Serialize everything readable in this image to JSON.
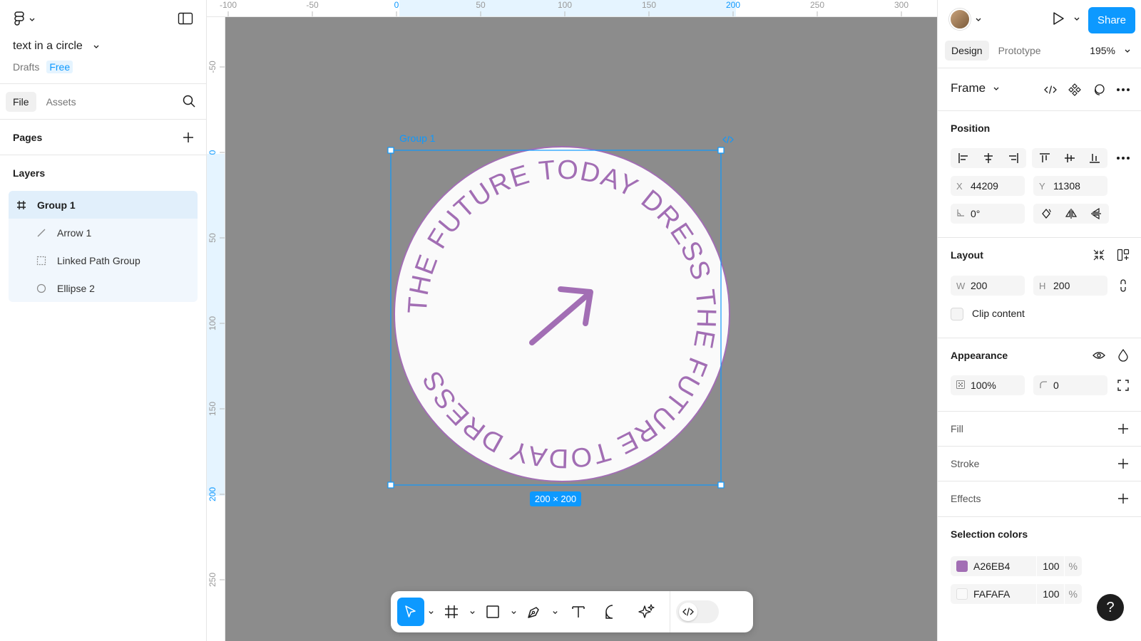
{
  "file": {
    "title": "text in a circle",
    "location": "Drafts",
    "plan_badge": "Free"
  },
  "left_tabs": {
    "file": "File",
    "assets": "Assets"
  },
  "pages_label": "Pages",
  "layers_label": "Layers",
  "layers": [
    {
      "name": "Group 1",
      "icon": "frame-grid-icon"
    },
    {
      "name": "Arrow 1",
      "icon": "line-icon"
    },
    {
      "name": "Linked Path Group",
      "icon": "dashed-box-icon"
    },
    {
      "name": "Ellipse 2",
      "icon": "ellipse-icon"
    }
  ],
  "ruler_top": [
    "-100",
    "-50",
    "0",
    "50",
    "100",
    "150",
    "200",
    "250",
    "300"
  ],
  "ruler_left": [
    "-50",
    "0",
    "50",
    "100",
    "150",
    "200",
    "250"
  ],
  "canvas": {
    "selection_label": "Group 1",
    "size_badge": "200 × 200",
    "circle_text": "THE FUTURE TODAY DRESS THE FUTURE TODAY DRESS",
    "accent_color": "#A26EB4",
    "fill_color": "#FAFAFA",
    "selection_color": "#0D99FF"
  },
  "right_panel": {
    "share_label": "Share",
    "tab_design": "Design",
    "tab_prototype": "Prototype",
    "zoom": "195%",
    "frame_label": "Frame",
    "position": {
      "title": "Position",
      "x_label": "X",
      "x_value": "44209",
      "y_label": "Y",
      "y_value": "11308",
      "rotation": "0°"
    },
    "layout": {
      "title": "Layout",
      "w_label": "W",
      "w_value": "200",
      "h_label": "H",
      "h_value": "200",
      "clip_content": "Clip content"
    },
    "appearance": {
      "title": "Appearance",
      "opacity": "100%",
      "radius": "0"
    },
    "fill_title": "Fill",
    "stroke_title": "Stroke",
    "effects_title": "Effects",
    "selection_colors": {
      "title": "Selection colors",
      "items": [
        {
          "hex": "A26EB4",
          "color": "#A26EB4",
          "opacity": "100",
          "unit": "%"
        },
        {
          "hex": "FAFAFA",
          "color": "#FAFAFA",
          "opacity": "100",
          "unit": "%"
        }
      ]
    },
    "help": "?"
  }
}
